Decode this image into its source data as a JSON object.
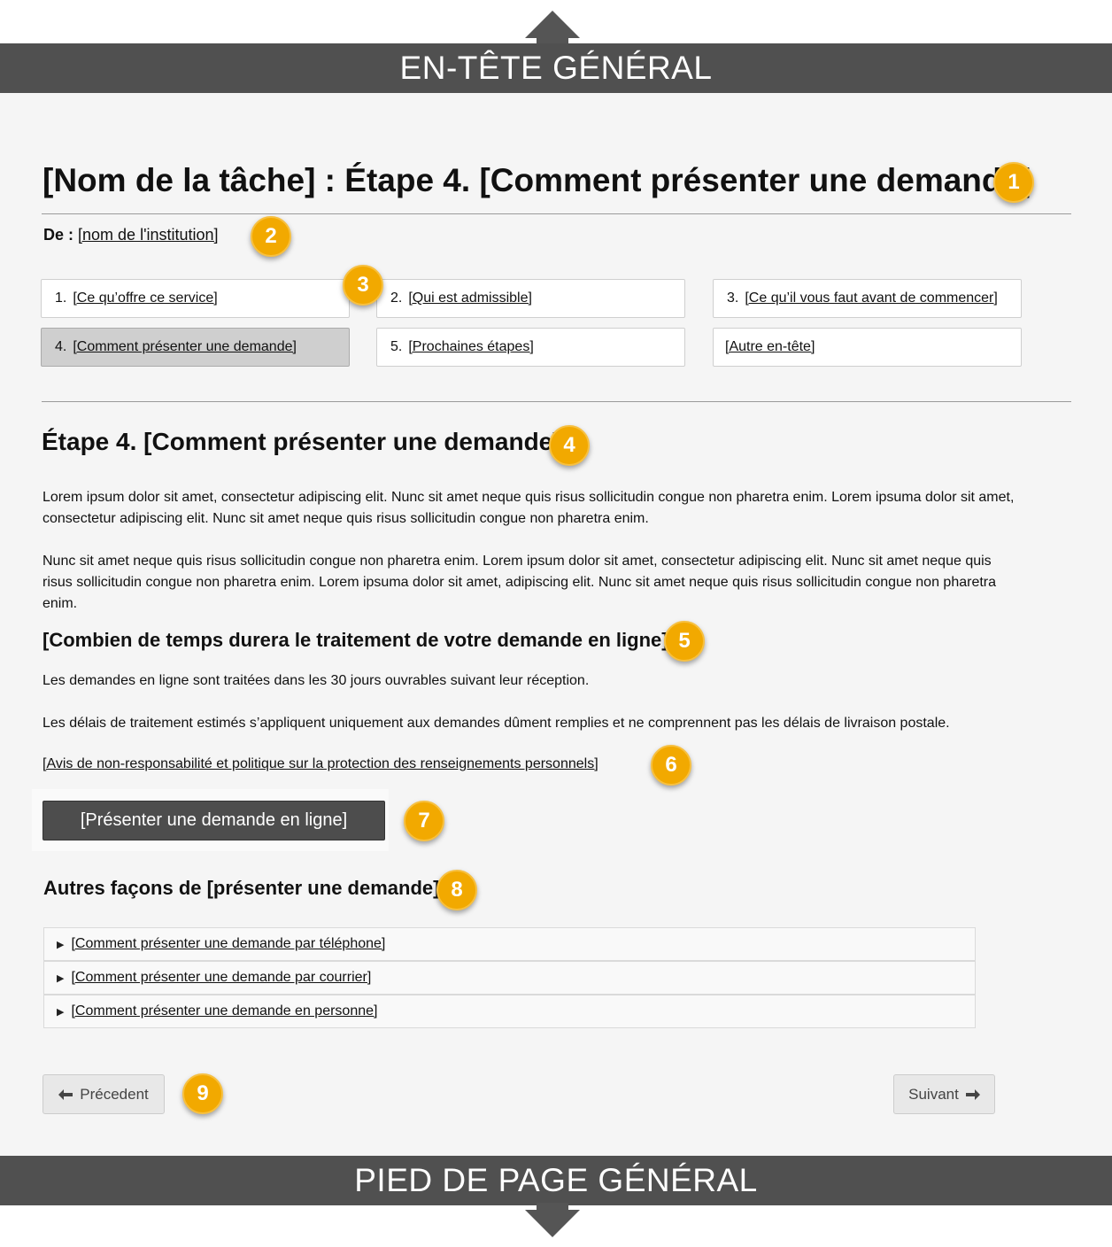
{
  "global_header": {
    "label": "EN-TÊTE GÉNÉRAL"
  },
  "global_footer": {
    "label": "PIED DE PAGE GÉNÉRAL"
  },
  "page": {
    "title": "[Nom de la tâche] : Étape 4. [Comment présenter une demande]",
    "from_label": "De :",
    "from_link": "[nom de l'institution]"
  },
  "steps": [
    {
      "num": "1.",
      "label": "[Ce qu’offre ce service]",
      "active": false
    },
    {
      "num": "2.",
      "label": "[Qui est admissible]",
      "active": false
    },
    {
      "num": "3.",
      "label": "[Ce qu’il vous faut avant de commencer]",
      "active": false
    },
    {
      "num": "4.",
      "label": "[Comment présenter une demande]",
      "active": true
    },
    {
      "num": "5.",
      "label": "[Prochaines étapes]",
      "active": false
    },
    {
      "num": "",
      "label": "[Autre en-tête]",
      "active": false
    }
  ],
  "section": {
    "heading": "Étape 4. [Comment présenter une demande]",
    "paragraph1": "Lorem ipsum dolor sit amet, consectetur adipiscing elit. Nunc sit amet neque quis  risus sollicitudin congue non pharetra enim. Lorem ipsuma dolor sit amet, consectetur adipiscing elit. Nunc sit amet neque quis risus sollicitudin congue non pharetra enim.",
    "paragraph2": "Nunc sit amet neque quis risus sollicitudin congue non pharetra enim.  Lorem ipsum dolor sit amet, consectetur adipiscing elit. Nunc sit amet neque quis  risus sollicitudin congue non pharetra enim. Lorem ipsuma dolor sit amet, adipiscing elit. Nunc sit amet neque quis risus sollicitudin congue non pharetra enim."
  },
  "processing": {
    "heading": "[Combien de temps durera le traitement de votre demande en ligne]",
    "line1": "Les demandes en ligne sont traitées dans les 30 jours ouvrables suivant leur réception.",
    "line2": "Les délais de traitement estimés s’appliquent uniquement aux demandes dûment remplies et ne comprennent pas les délais de livraison postale.",
    "disclaimer_link": "[Avis de non-responsabilité et politique sur la protection des renseignements personnels]"
  },
  "cta": {
    "label": "[Présenter une demande en ligne]"
  },
  "other_ways": {
    "heading": "Autres façons de [présenter une demande]",
    "items": [
      "[Comment présenter une demande par téléphone]",
      "[Comment présenter une demande par courrier]",
      "[Comment présenter une demande en personne]"
    ]
  },
  "pager": {
    "previous": "Précedent",
    "next": "Suivant"
  },
  "badges": [
    "1",
    "2",
    "3",
    "4",
    "5",
    "6",
    "7",
    "8",
    "9"
  ],
  "colors": {
    "band": "#505050",
    "badge": "#f2a900",
    "cta": "#4d4d4d",
    "content_bg": "#f5f5f5"
  }
}
